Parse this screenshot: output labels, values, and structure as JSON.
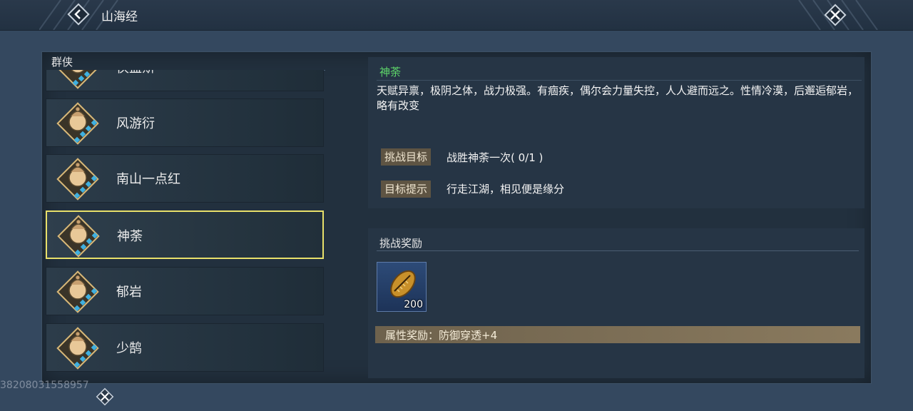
{
  "header": {
    "title": "山海经"
  },
  "sidebar": {
    "group_label": "群侠",
    "items": [
      {
        "name": "侠盗斯"
      },
      {
        "name": "风游衍"
      },
      {
        "name": "南山一点红"
      },
      {
        "name": "神荼"
      },
      {
        "name": "郁岩"
      },
      {
        "name": "少鹄"
      }
    ],
    "selected_index": 3
  },
  "detail": {
    "name": "神荼",
    "description": "天赋异禀，极阴之体，战力极强。有痼疾，偶尔会力量失控，人人避而远之。性情冷漠，后邂逅郁岩，略有改变",
    "goal_label": "挑战目标",
    "goal_value": "战胜神荼一次( 0/1 )",
    "hint_label": "目标提示",
    "hint_value": "行走江湖，相见便是缘分"
  },
  "reward": {
    "title": "挑战奖励",
    "items": [
      {
        "icon": "seed-pod-icon",
        "count": "200"
      }
    ],
    "attr_bonus": "属性奖励：防御穿透+4"
  },
  "footer": {
    "uid": "38208031558957"
  },
  "colors": {
    "accent_green": "#5ed66a",
    "selected_border": "#e8e06a",
    "tag_bg": "#5e5443"
  }
}
